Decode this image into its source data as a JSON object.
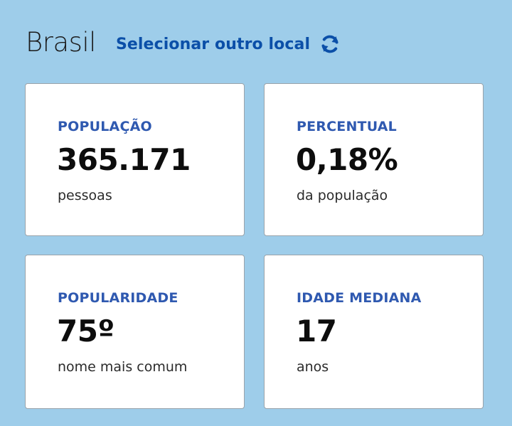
{
  "header": {
    "location": "Brasil",
    "select_label": "Selecionar outro local",
    "select_icon": "refresh-icon"
  },
  "colors": {
    "background": "#9ecdea",
    "link": "#0b4fa8",
    "card_label": "#2f59b0",
    "card_value": "#0d0d0d"
  },
  "cards": [
    {
      "label": "POPULAÇÃO",
      "value": "365.171",
      "unit": "pessoas"
    },
    {
      "label": "PERCENTUAL",
      "value": "0,18%",
      "unit": "da população"
    },
    {
      "label": "POPULARIDADE",
      "value": "75º",
      "unit": "nome mais comum"
    },
    {
      "label": "IDADE MEDIANA",
      "value": "17",
      "unit": "anos"
    }
  ]
}
